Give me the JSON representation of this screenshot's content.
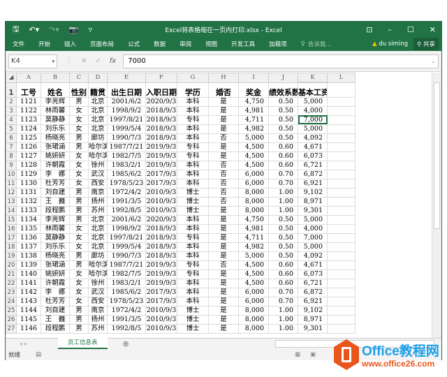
{
  "window": {
    "title": "Excel将表格缩在一页内打印.xlsx - Excel"
  },
  "ribbon": {
    "tabs": [
      "文件",
      "开始",
      "插入",
      "页面布局",
      "公式",
      "数据",
      "审阅",
      "视图",
      "开发工具",
      "加载项"
    ],
    "tell_me": "告诉我...",
    "user": "du siming",
    "share": "共享"
  },
  "formula_bar": {
    "name_box": "K4",
    "value": "7000"
  },
  "columns": [
    "A",
    "B",
    "C",
    "D",
    "E",
    "F",
    "G",
    "H",
    "I",
    "J",
    "K",
    "L"
  ],
  "headers": [
    "工号",
    "姓名",
    "性别",
    "籍贯",
    "出生日期",
    "入职日期",
    "学历",
    "婚否",
    "奖金",
    "绩效系数",
    "基本工资"
  ],
  "rows": [
    [
      "1121",
      "李亮辉",
      "男",
      "北京",
      "2001/6/2",
      "2020/9/3",
      "本科",
      "是",
      "4,750",
      "0.50",
      "5,000"
    ],
    [
      "1122",
      "林雨馨",
      "女",
      "北京",
      "1998/9/2",
      "2018/9/3",
      "本科",
      "是",
      "4,981",
      "0.50",
      "4,000"
    ],
    [
      "1123",
      "莫静静",
      "女",
      "北京",
      "1997/8/21",
      "2018/9/3",
      "专科",
      "是",
      "4,711",
      "0.50",
      "7,000"
    ],
    [
      "1124",
      "刘乐乐",
      "女",
      "北京",
      "1999/5/4",
      "2018/9/3",
      "本科",
      "是",
      "4,982",
      "0.50",
      "5,000"
    ],
    [
      "1125",
      "杨晓亮",
      "男",
      "廊坊",
      "1990/7/3",
      "2018/9/3",
      "本科",
      "否",
      "5,000",
      "0.50",
      "4,092"
    ],
    [
      "1126",
      "张珺涵",
      "男",
      "哈尔滨",
      "1987/7/21",
      "2019/9/3",
      "专科",
      "是",
      "4,500",
      "0.60",
      "4,671"
    ],
    [
      "1127",
      "姚妍妍",
      "女",
      "哈尔滨",
      "1982/7/5",
      "2019/9/3",
      "专科",
      "是",
      "4,500",
      "0.60",
      "6,073"
    ],
    [
      "1128",
      "许朝霞",
      "女",
      "徐州",
      "1983/2/1",
      "2019/9/3",
      "本科",
      "否",
      "4,500",
      "0.60",
      "6,721"
    ],
    [
      "1129",
      "李　娜",
      "女",
      "武汉",
      "1985/6/2",
      "2017/9/3",
      "本科",
      "否",
      "6,000",
      "0.70",
      "6,872"
    ],
    [
      "1130",
      "杜芳芳",
      "女",
      "西安",
      "1978/5/23",
      "2017/9/3",
      "本科",
      "否",
      "6,000",
      "0.70",
      "6,921"
    ],
    [
      "1131",
      "刘自建",
      "男",
      "南京",
      "1972/4/2",
      "2010/9/3",
      "博士",
      "否",
      "8,000",
      "1.00",
      "9,102"
    ],
    [
      "1132",
      "王　巍",
      "男",
      "扬州",
      "1991/3/5",
      "2010/9/3",
      "博士",
      "否",
      "8,000",
      "1.00",
      "8,971"
    ],
    [
      "1133",
      "段程鹏",
      "男",
      "苏州",
      "1992/8/5",
      "2010/9/3",
      "博士",
      "是",
      "8,000",
      "1.00",
      "9,301"
    ],
    [
      "1134",
      "李亮辉",
      "男",
      "北京",
      "2001/6/2",
      "2020/9/3",
      "本科",
      "是",
      "4,750",
      "0.50",
      "5,000"
    ],
    [
      "1135",
      "林雨馨",
      "女",
      "北京",
      "1998/9/2",
      "2018/9/3",
      "本科",
      "是",
      "4,981",
      "0.50",
      "4,000"
    ],
    [
      "1136",
      "莫静静",
      "女",
      "北京",
      "1997/8/21",
      "2018/9/3",
      "专科",
      "是",
      "4,711",
      "0.50",
      "7,000"
    ],
    [
      "1137",
      "刘乐乐",
      "女",
      "北京",
      "1999/5/4",
      "2018/9/3",
      "本科",
      "是",
      "4,982",
      "0.50",
      "5,000"
    ],
    [
      "1138",
      "杨晓亮",
      "男",
      "廊坊",
      "1990/7/3",
      "2018/9/3",
      "本科",
      "是",
      "5,000",
      "0.50",
      "4,092"
    ],
    [
      "1139",
      "张珺涵",
      "男",
      "哈尔滨",
      "1987/7/21",
      "2019/9/3",
      "专科",
      "否",
      "4,500",
      "0.60",
      "4,671"
    ],
    [
      "1140",
      "姚妍妍",
      "女",
      "哈尔滨",
      "1982/7/5",
      "2019/9/3",
      "专科",
      "是",
      "4,500",
      "0.60",
      "6,073"
    ],
    [
      "1141",
      "许朝霞",
      "女",
      "徐州",
      "1983/2/1",
      "2019/9/3",
      "本科",
      "是",
      "4,500",
      "0.60",
      "6,721"
    ],
    [
      "1142",
      "李　娜",
      "女",
      "武汉",
      "1985/6/2",
      "2017/9/3",
      "本科",
      "是",
      "6,000",
      "0.70",
      "6,872"
    ],
    [
      "1143",
      "杜芳芳",
      "女",
      "西安",
      "1978/5/23",
      "2017/9/3",
      "本科",
      "是",
      "6,000",
      "0.70",
      "6,921"
    ],
    [
      "1144",
      "刘自建",
      "男",
      "南京",
      "1972/4/2",
      "2010/9/3",
      "博士",
      "是",
      "8,000",
      "1.00",
      "9,102"
    ],
    [
      "1145",
      "王　巍",
      "男",
      "扬州",
      "1991/3/5",
      "2010/9/3",
      "博士",
      "是",
      "8,000",
      "1.00",
      "8,971"
    ],
    [
      "1146",
      "段程鹏",
      "男",
      "苏州",
      "1992/8/5",
      "2010/9/3",
      "博士",
      "是",
      "8,000",
      "1.00",
      "9,301"
    ]
  ],
  "selected_cell": "K4",
  "sheet_tab": "员工信息表",
  "status": {
    "ready": "就绪"
  },
  "watermark": {
    "brand": "Office教程网",
    "url": "www.office26.com"
  },
  "colors": {
    "accent": "#217346",
    "watermark_orange": "#e8561b",
    "watermark_blue": "#1aa0e8"
  }
}
